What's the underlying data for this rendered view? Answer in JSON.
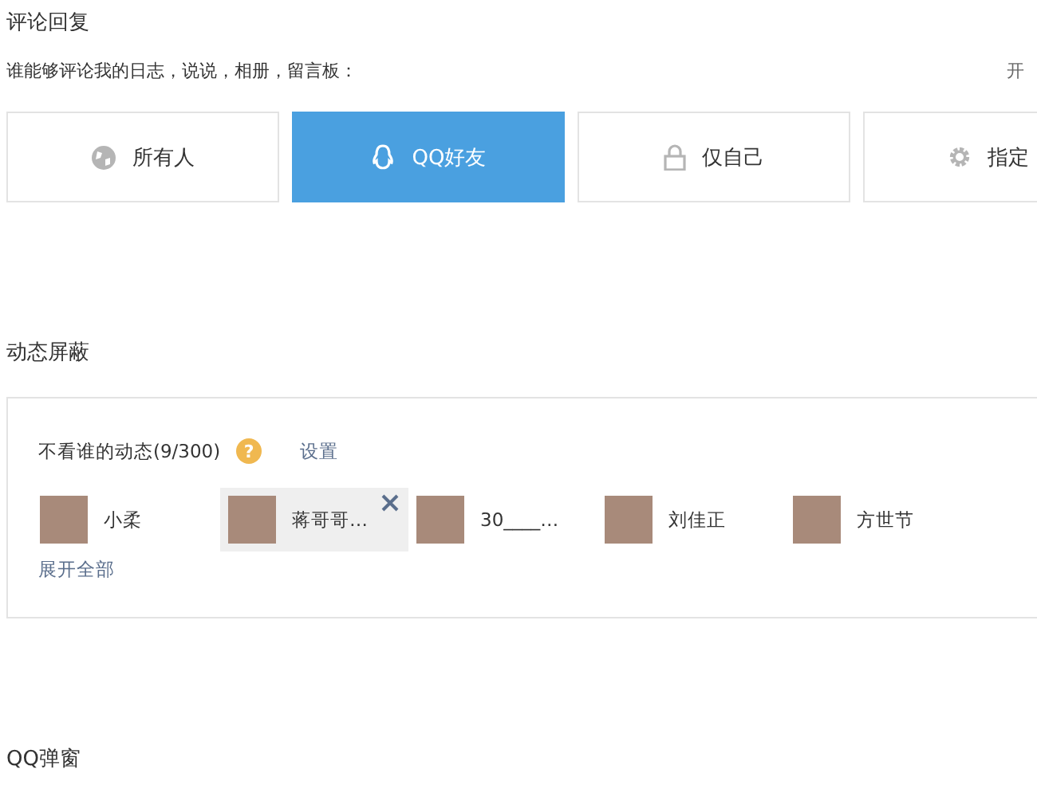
{
  "comment_reply": {
    "title": "评论回复",
    "question": "谁能够评论我的日志，说说，相册，留言板：",
    "right_text": "开",
    "options": [
      {
        "label": "所有人",
        "selected": false
      },
      {
        "label": "QQ好友",
        "selected": true
      },
      {
        "label": "仅自己",
        "selected": false
      },
      {
        "label": "指定",
        "selected": false
      }
    ]
  },
  "feed_block": {
    "title": "动态屏蔽",
    "label": "不看谁的动态(9/300)",
    "help": "?",
    "settings_link": "设置",
    "friends": [
      {
        "name": "小柔",
        "selected": false
      },
      {
        "name": "蒋哥哥…",
        "selected": true
      },
      {
        "name": "30____…",
        "selected": false
      },
      {
        "name": "刘佳正",
        "selected": false
      },
      {
        "name": "方世节",
        "selected": false
      }
    ],
    "expand_link": "展开全部"
  },
  "qq_popup": {
    "title": "QQ弹窗"
  }
}
